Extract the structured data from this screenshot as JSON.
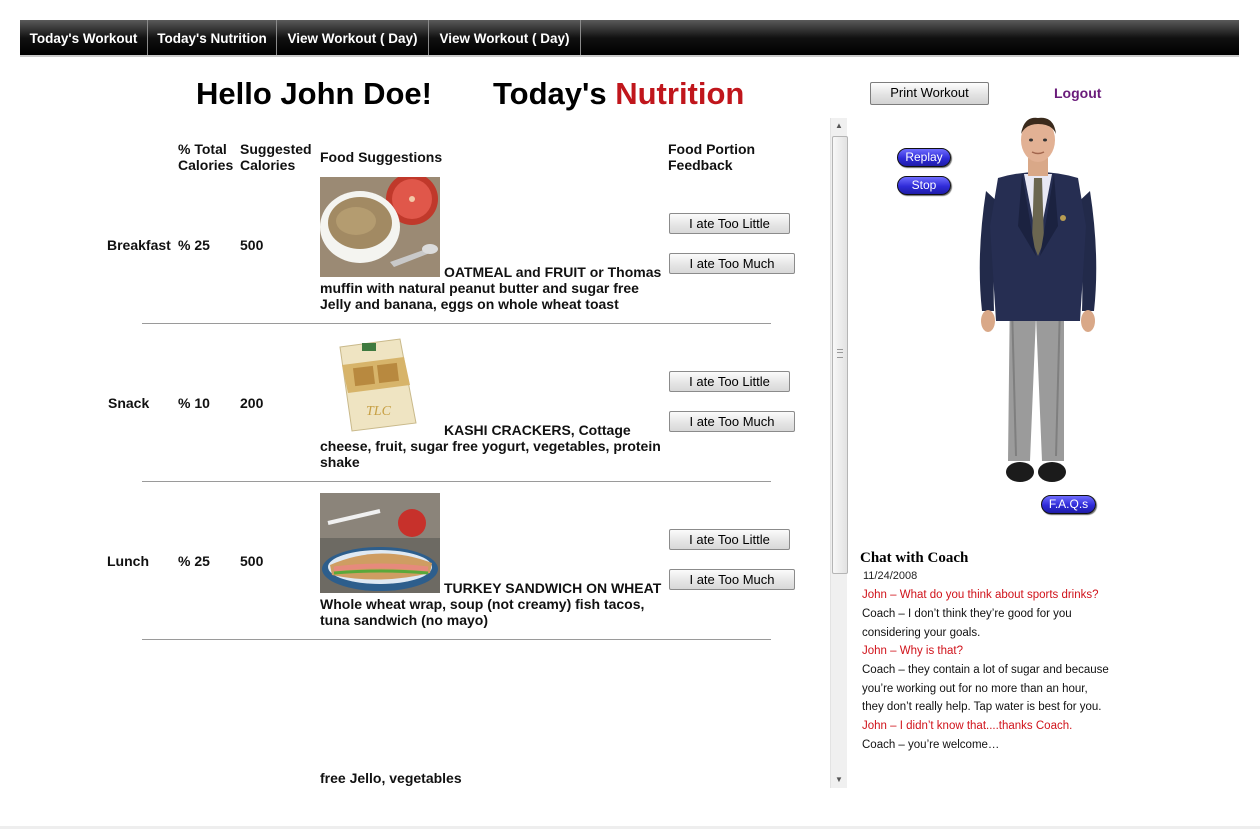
{
  "nav": {
    "items": [
      "Today's Workout",
      "Today's Nutrition",
      "View Workout ( Day)",
      "View Workout ( Day)"
    ]
  },
  "header": {
    "greeting": "Hello John Doe!",
    "title_prefix": "Today's",
    "title_accent": "Nutrition",
    "accent_color": "#c0161c"
  },
  "table": {
    "col_pct": "% Total Calories",
    "col_pct_line1": "% Total",
    "col_pct_line2": "Calories",
    "col_suggested_line1": "Suggested",
    "col_suggested_line2": "Calories",
    "col_food": "Food Suggestions",
    "col_feedback_line1": "Food Portion",
    "col_feedback_line2": "Feedback",
    "rows": [
      {
        "meal": "Breakfast",
        "pct": "% 25",
        "calories": "500",
        "food_inline": "OATMEAL and FRUIT or Thomas",
        "food_rest": "muffin with natural peanut butter and sugar free Jelly and banana, eggs on whole wheat toast",
        "image": "oatmeal-grapefruit-photo",
        "btn_little": "I ate Too Little",
        "btn_much": "I ate Too Much"
      },
      {
        "meal": "Snack",
        "pct": "% 10",
        "calories": "200",
        "food_inline": "KASHI CRACKERS, Cottage",
        "food_rest": "cheese, fruit, sugar free yogurt, vegetables, protein shake",
        "image": "kashi-bars-box-photo",
        "btn_little": "I ate Too Little",
        "btn_much": "I ate Too Much"
      },
      {
        "meal": "Lunch",
        "pct": "% 25",
        "calories": "500",
        "food_inline": "TURKEY SANDWICH ON WHEAT",
        "food_rest": "Whole wheat wrap, soup (not creamy) fish tacos, tuna sandwich (no mayo)",
        "image": "turkey-sandwich-photo",
        "btn_little": "I ate Too Little",
        "btn_much": "I ate Too Much"
      }
    ],
    "trailing_text": "free Jello, vegetables"
  },
  "right_panel": {
    "print_label": "Print Workout",
    "logout_label": "Logout",
    "replay_label": "Replay",
    "stop_label": "Stop",
    "faq_label": "F.A.Q.s",
    "avatar": "3d-coach-avatar"
  },
  "chat": {
    "title": "Chat with Coach",
    "date": "11/24/2008",
    "lines": [
      {
        "who": "john",
        "text": "John – What do you think about sports drinks?"
      },
      {
        "who": "coach",
        "text": "Coach – I don’t think they’re good for you"
      },
      {
        "who": "coach",
        "text": "considering your goals."
      },
      {
        "who": "john",
        "text": "John – Why is that?"
      },
      {
        "who": "coach",
        "text": "Coach – they contain a lot of sugar and because"
      },
      {
        "who": "coach",
        "text": "you’re working out for no more than an hour,"
      },
      {
        "who": "coach",
        "text": "they don’t really help.  Tap water is best for you."
      },
      {
        "who": "john",
        "text": "John – I didn’t know that....thanks  Coach."
      },
      {
        "who": "coach",
        "text": "Coach – you’re welcome…"
      }
    ]
  }
}
